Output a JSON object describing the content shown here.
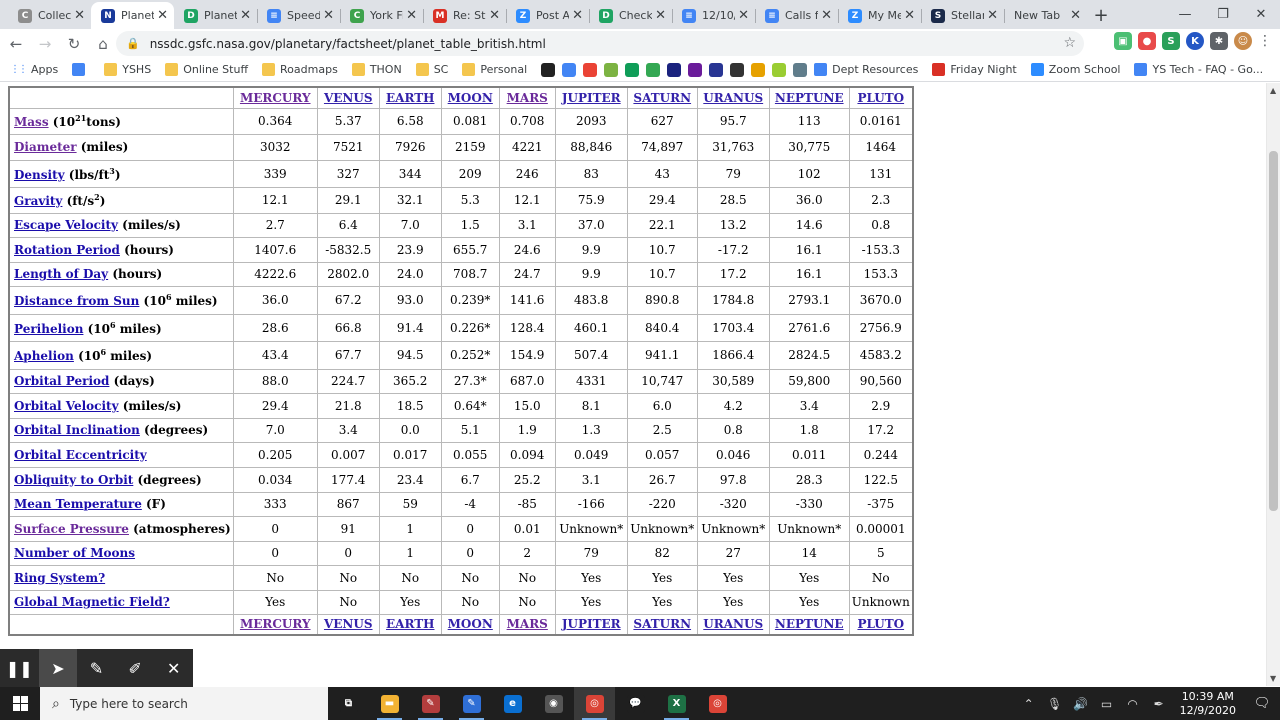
{
  "tabs": [
    {
      "title": "Collect",
      "icon": "google-classroom-icon",
      "color": "#8d8d8d",
      "glyph": "C",
      "active": false
    },
    {
      "title": "Planet",
      "icon": "nasa-icon",
      "color": "#1a3a9a",
      "glyph": "N",
      "active": true
    },
    {
      "title": "Planet",
      "icon": "google-drive-icon",
      "color": "#1fa463",
      "glyph": "D",
      "active": false
    },
    {
      "title": "Speed",
      "icon": "google-docs-icon",
      "color": "#4285f4",
      "glyph": "≡",
      "active": false
    },
    {
      "title": "York Fi",
      "icon": "green-c-icon",
      "color": "#3fa34d",
      "glyph": "C",
      "active": false
    },
    {
      "title": "Re: Ste",
      "icon": "gmail-icon",
      "color": "#d93025",
      "glyph": "M",
      "active": false
    },
    {
      "title": "Post A",
      "icon": "zoom-icon",
      "color": "#2d8cff",
      "glyph": "Z",
      "active": false
    },
    {
      "title": "Check",
      "icon": "google-drive-icon",
      "color": "#1fa463",
      "glyph": "D",
      "active": false
    },
    {
      "title": "12/10/",
      "icon": "google-docs-icon",
      "color": "#4285f4",
      "glyph": "≡",
      "active": false
    },
    {
      "title": "Calls fr",
      "icon": "google-docs-icon",
      "color": "#4285f4",
      "glyph": "≡",
      "active": false
    },
    {
      "title": "My Me",
      "icon": "zoom-icon",
      "color": "#2d8cff",
      "glyph": "Z",
      "active": false
    },
    {
      "title": "Stellar",
      "icon": "stellarium-icon",
      "color": "#1b2a4a",
      "glyph": "S",
      "active": false
    },
    {
      "title": "New Tab",
      "icon": "",
      "color": "",
      "glyph": "",
      "active": false
    }
  ],
  "omnibox": {
    "url": "nssdc.gsfc.nasa.gov/planetary/factsheet/planet_table_british.html"
  },
  "bookmarks": [
    {
      "label": "Apps",
      "kind": "apps"
    },
    {
      "label": "",
      "kind": "docs",
      "color": "#4285f4"
    },
    {
      "label": "YSHS",
      "kind": "folder"
    },
    {
      "label": "Online Stuff",
      "kind": "folder"
    },
    {
      "label": "Roadmaps",
      "kind": "folder"
    },
    {
      "label": "THON",
      "kind": "folder"
    },
    {
      "label": "SC",
      "kind": "folder"
    },
    {
      "label": "Personal",
      "kind": "folder"
    },
    {
      "label": "Dept Resources",
      "kind": "docs",
      "color": "#4285f4"
    },
    {
      "label": "Friday Night",
      "kind": "site",
      "color": "#d93025"
    },
    {
      "label": "Zoom School",
      "kind": "site",
      "color": "#2d8cff"
    },
    {
      "label": "YS Tech - FAQ - Go...",
      "kind": "docs",
      "color": "#4285f4"
    }
  ],
  "bookmark_icons": [
    "#222222",
    "#4285f4",
    "#ea4335",
    "#7cb342",
    "#0f9d58",
    "#34a853",
    "#1a237e",
    "#6a1b9a",
    "#283593",
    "#333333",
    "#e6a100",
    "#9acd32",
    "#607d8b"
  ],
  "planets": [
    {
      "name": "MERCURY",
      "visited": true
    },
    {
      "name": "VENUS",
      "visited": false
    },
    {
      "name": "EARTH",
      "visited": false
    },
    {
      "name": "MOON",
      "visited": false
    },
    {
      "name": "MARS",
      "visited": true
    },
    {
      "name": "JUPITER",
      "visited": false
    },
    {
      "name": "SATURN",
      "visited": false
    },
    {
      "name": "URANUS",
      "visited": false
    },
    {
      "name": "NEPTUNE",
      "visited": false
    },
    {
      "name": "PLUTO",
      "visited": false
    }
  ],
  "rows": [
    {
      "link": "Mass",
      "unit_pre": " (10",
      "sup": "21",
      "unit_post": "tons)",
      "visited": true,
      "values": [
        "0.364",
        "5.37",
        "6.58",
        "0.081",
        "0.708",
        "2093",
        "627",
        "95.7",
        "113",
        "0.0161"
      ]
    },
    {
      "link": "Diameter",
      "unit_pre": " (miles)",
      "sup": "",
      "unit_post": "",
      "visited": true,
      "values": [
        "3032",
        "7521",
        "7926",
        "2159",
        "4221",
        "88,846",
        "74,897",
        "31,763",
        "30,775",
        "1464"
      ]
    },
    {
      "link": "Density",
      "unit_pre": " (lbs/ft",
      "sup": "3",
      "unit_post": ")",
      "visited": false,
      "values": [
        "339",
        "327",
        "344",
        "209",
        "246",
        "83",
        "43",
        "79",
        "102",
        "131"
      ]
    },
    {
      "link": "Gravity",
      "unit_pre": " (ft/s",
      "sup": "2",
      "unit_post": ")",
      "visited": false,
      "values": [
        "12.1",
        "29.1",
        "32.1",
        "5.3",
        "12.1",
        "75.9",
        "29.4",
        "28.5",
        "36.0",
        "2.3"
      ]
    },
    {
      "link": "Escape Velocity",
      "unit_pre": " (miles/s)",
      "sup": "",
      "unit_post": "",
      "visited": false,
      "values": [
        "2.7",
        "6.4",
        "7.0",
        "1.5",
        "3.1",
        "37.0",
        "22.1",
        "13.2",
        "14.6",
        "0.8"
      ]
    },
    {
      "link": "Rotation Period",
      "unit_pre": " (hours)",
      "sup": "",
      "unit_post": "",
      "visited": false,
      "values": [
        "1407.6",
        "-5832.5",
        "23.9",
        "655.7",
        "24.6",
        "9.9",
        "10.7",
        "-17.2",
        "16.1",
        "-153.3"
      ]
    },
    {
      "link": "Length of Day",
      "unit_pre": " (hours)",
      "sup": "",
      "unit_post": "",
      "visited": false,
      "values": [
        "4222.6",
        "2802.0",
        "24.0",
        "708.7",
        "24.7",
        "9.9",
        "10.7",
        "17.2",
        "16.1",
        "153.3"
      ]
    },
    {
      "link": "Distance from Sun",
      "unit_pre": " (10",
      "sup": "6",
      "unit_post": " miles)",
      "visited": false,
      "values": [
        "36.0",
        "67.2",
        "93.0",
        "0.239*",
        "141.6",
        "483.8",
        "890.8",
        "1784.8",
        "2793.1",
        "3670.0"
      ]
    },
    {
      "link": "Perihelion",
      "unit_pre": " (10",
      "sup": "6",
      "unit_post": " miles)",
      "visited": false,
      "values": [
        "28.6",
        "66.8",
        "91.4",
        "0.226*",
        "128.4",
        "460.1",
        "840.4",
        "1703.4",
        "2761.6",
        "2756.9"
      ]
    },
    {
      "link": "Aphelion",
      "unit_pre": " (10",
      "sup": "6",
      "unit_post": " miles)",
      "visited": false,
      "values": [
        "43.4",
        "67.7",
        "94.5",
        "0.252*",
        "154.9",
        "507.4",
        "941.1",
        "1866.4",
        "2824.5",
        "4583.2"
      ]
    },
    {
      "link": "Orbital Period",
      "unit_pre": " (days)",
      "sup": "",
      "unit_post": "",
      "visited": false,
      "values": [
        "88.0",
        "224.7",
        "365.2",
        "27.3*",
        "687.0",
        "4331",
        "10,747",
        "30,589",
        "59,800",
        "90,560"
      ]
    },
    {
      "link": "Orbital Velocity",
      "unit_pre": " (miles/s)",
      "sup": "",
      "unit_post": "",
      "visited": false,
      "values": [
        "29.4",
        "21.8",
        "18.5",
        "0.64*",
        "15.0",
        "8.1",
        "6.0",
        "4.2",
        "3.4",
        "2.9"
      ]
    },
    {
      "link": "Orbital Inclination",
      "unit_pre": " (degrees)",
      "sup": "",
      "unit_post": "",
      "visited": false,
      "values": [
        "7.0",
        "3.4",
        "0.0",
        "5.1",
        "1.9",
        "1.3",
        "2.5",
        "0.8",
        "1.8",
        "17.2"
      ]
    },
    {
      "link": "Orbital Eccentricity",
      "unit_pre": "",
      "sup": "",
      "unit_post": "",
      "visited": false,
      "values": [
        "0.205",
        "0.007",
        "0.017",
        "0.055",
        "0.094",
        "0.049",
        "0.057",
        "0.046",
        "0.011",
        "0.244"
      ]
    },
    {
      "link": "Obliquity to Orbit",
      "unit_pre": " (degrees)",
      "sup": "",
      "unit_post": "",
      "visited": false,
      "values": [
        "0.034",
        "177.4",
        "23.4",
        "6.7",
        "25.2",
        "3.1",
        "26.7",
        "97.8",
        "28.3",
        "122.5"
      ]
    },
    {
      "link": "Mean Temperature",
      "unit_pre": " (F)",
      "sup": "",
      "unit_post": "",
      "visited": false,
      "values": [
        "333",
        "867",
        "59",
        "-4",
        "-85",
        "-166",
        "-220",
        "-320",
        "-330",
        "-375"
      ]
    },
    {
      "link": "Surface Pressure",
      "unit_pre": " (atmospheres)",
      "sup": "",
      "unit_post": "",
      "visited": true,
      "values": [
        "0",
        "91",
        "1",
        "0",
        "0.01",
        "Unknown*",
        "Unknown*",
        "Unknown*",
        "Unknown*",
        "0.00001"
      ]
    },
    {
      "link": "Number of Moons",
      "unit_pre": "",
      "sup": "",
      "unit_post": "",
      "visited": false,
      "values": [
        "0",
        "0",
        "1",
        "0",
        "2",
        "79",
        "82",
        "27",
        "14",
        "5"
      ]
    },
    {
      "link": "Ring System?",
      "unit_pre": "",
      "sup": "",
      "unit_post": "",
      "visited": false,
      "values": [
        "No",
        "No",
        "No",
        "No",
        "No",
        "Yes",
        "Yes",
        "Yes",
        "Yes",
        "No"
      ]
    },
    {
      "link": "Global Magnetic Field?",
      "unit_pre": "",
      "sup": "",
      "unit_post": "",
      "visited": false,
      "values": [
        "Yes",
        "No",
        "Yes",
        "No",
        "No",
        "Yes",
        "Yes",
        "Yes",
        "Yes",
        "Unknown"
      ]
    }
  ],
  "taskbar": {
    "search_placeholder": "Type here to search",
    "apps": [
      {
        "name": "task-view",
        "color": "#1f1f1f",
        "glyph": "⧉",
        "running": false,
        "active": false
      },
      {
        "name": "file-explorer",
        "color": "#f2b233",
        "glyph": "▬",
        "running": true,
        "active": false
      },
      {
        "name": "paint",
        "color": "#b33d3d",
        "glyph": "✎",
        "running": true,
        "active": false
      },
      {
        "name": "notepad",
        "color": "#2f6fd6",
        "glyph": "✎",
        "running": true,
        "active": false
      },
      {
        "name": "edge",
        "color": "#0a6fd1",
        "glyph": "e",
        "running": false,
        "active": false
      },
      {
        "name": "camera",
        "color": "#555555",
        "glyph": "◉",
        "running": false,
        "active": false
      },
      {
        "name": "chrome",
        "color": "#db4437",
        "glyph": "◎",
        "running": true,
        "active": true
      },
      {
        "name": "chat",
        "color": "#1f1f1f",
        "glyph": "💬",
        "running": false,
        "active": false
      },
      {
        "name": "excel",
        "color": "#1e7145",
        "glyph": "X",
        "running": true,
        "active": false
      },
      {
        "name": "chrome-2",
        "color": "#db4437",
        "glyph": "◎",
        "running": false,
        "active": false
      }
    ],
    "time": "10:39 AM",
    "date": "12/9/2020"
  }
}
